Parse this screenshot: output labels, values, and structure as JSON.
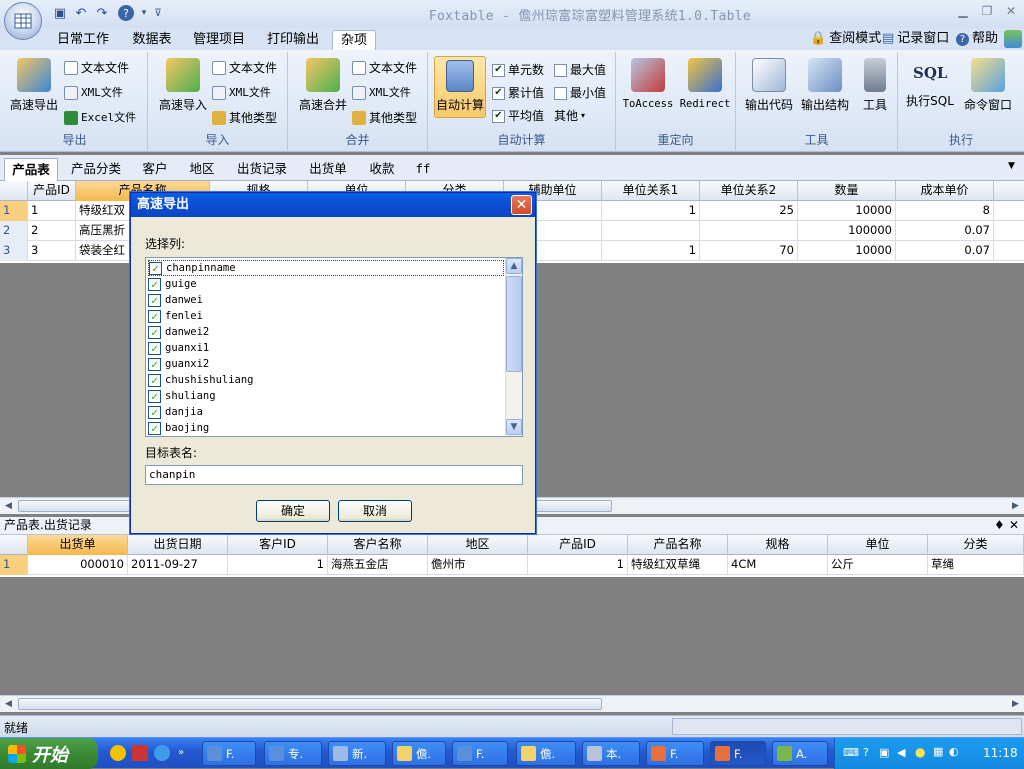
{
  "window": {
    "title": "Foxtable - 儋州琮富琮富塑料管理系统1.0.Table"
  },
  "menu": {
    "tabs": [
      "日常工作",
      "数据表",
      "管理项目",
      "打印输出",
      "杂项"
    ],
    "active": "杂项",
    "right_links": [
      "查阅模式",
      "记录窗口",
      "帮助"
    ]
  },
  "ribbon": {
    "export": {
      "big": "高速导出",
      "items": [
        "文本文件",
        "XML文件",
        "Excel文件"
      ],
      "label": "导出"
    },
    "import": {
      "big": "高速导入",
      "items": [
        "文本文件",
        "XML文件",
        "其他类型"
      ],
      "label": "导入"
    },
    "merge": {
      "big": "高速合并",
      "items": [
        "文本文件",
        "XML文件",
        "其他类型"
      ],
      "label": "合并"
    },
    "autocalc": {
      "big": "自动计算",
      "checks": [
        "单元数",
        "累计值",
        "平均值",
        "最大值",
        "最小值"
      ],
      "other": "其他",
      "label": "自动计算"
    },
    "redirect": {
      "items": [
        "ToAccess",
        "Redirect"
      ],
      "label": "重定向"
    },
    "tools": {
      "items": [
        "输出代码",
        "输出结构",
        "工具"
      ],
      "label": "工具"
    },
    "exec": {
      "items": [
        "执行SQL",
        "命令窗口"
      ],
      "sql_glyph": "SQL",
      "label": "执行"
    }
  },
  "table_tabs": [
    "产品表",
    "产品分类",
    "客户",
    "地区",
    "出货记录",
    "出货单",
    "收款",
    "ff"
  ],
  "main_grid": {
    "headers": [
      "产品ID",
      "产品名称",
      "规格",
      "单位",
      "分类",
      "辅助单位",
      "单位关系1",
      "单位关系2",
      "数量",
      "成本单价"
    ],
    "rows": [
      {
        "num": "1",
        "cells": [
          "1",
          "特级红双",
          "",
          "",
          "",
          "",
          "1",
          "25",
          "10000",
          "8"
        ]
      },
      {
        "num": "2",
        "cells": [
          "2",
          "高压黑折",
          "",
          "",
          "",
          "",
          "",
          "",
          "100000",
          "0.07"
        ]
      },
      {
        "num": "3",
        "cells": [
          "3",
          "袋装全红",
          "",
          "",
          "",
          "",
          "1",
          "70",
          "10000",
          "0.07"
        ]
      }
    ]
  },
  "subtable": {
    "title": "产品表.出货记录",
    "pin_glyph": "♦",
    "close_glyph": "✕",
    "headers": [
      "出货单",
      "出货日期",
      "客户ID",
      "客户名称",
      "地区",
      "产品ID",
      "产品名称",
      "规格",
      "单位",
      "分类"
    ],
    "rows": [
      {
        "num": "1",
        "cells": [
          "000010",
          "2011-09-27",
          "1",
          "海燕五金店",
          "儋州市",
          "1",
          "特级红双草绳",
          "4CM",
          "公斤",
          "草绳"
        ]
      }
    ]
  },
  "dialog": {
    "title": "高速导出",
    "columns_label": "选择列:",
    "columns": [
      "chanpinname",
      "guige",
      "danwei",
      "fenlei",
      "danwei2",
      "guanxi1",
      "guanxi2",
      "chushishuliang",
      "shuliang",
      "danjia",
      "baojing"
    ],
    "target_label": "目标表名:",
    "target_value": "chanpin",
    "ok": "确定",
    "cancel": "取消"
  },
  "status": {
    "text": "就绪"
  },
  "taskbar": {
    "start": "开始",
    "buttons": [
      "F.",
      "专.",
      "新.",
      "儋.",
      "F.",
      "儋.",
      "本.",
      "F.",
      "F.",
      "A."
    ],
    "clock": "11:18"
  }
}
